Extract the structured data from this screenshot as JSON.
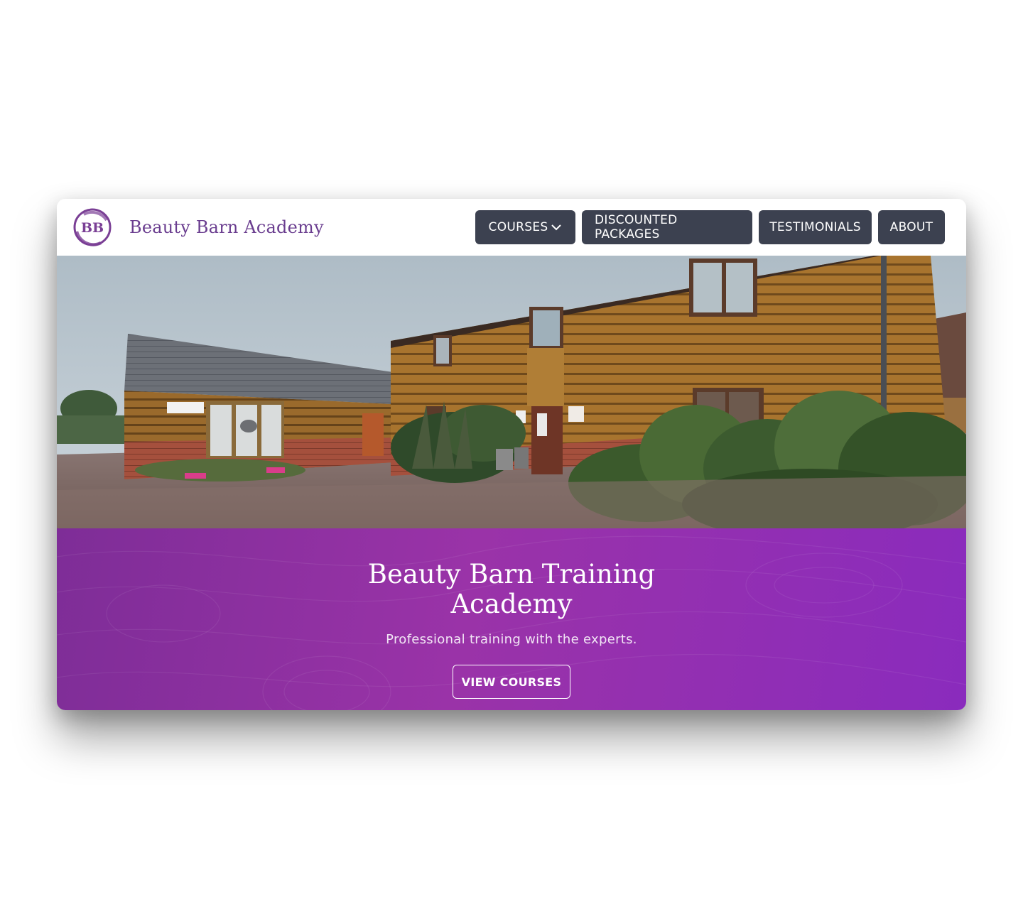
{
  "brand": {
    "logo_text": "BB",
    "name": "Beauty Barn Academy"
  },
  "nav": {
    "courses": "COURSES",
    "packages": "DISCOUNTED PACKAGES",
    "testimonials": "TESTIMONIALS",
    "about": "ABOUT"
  },
  "carousel": {
    "slide_count": 5,
    "active_index": 0
  },
  "hero": {
    "title": "Beauty Barn Training Academy",
    "subtitle": "Professional training with the experts.",
    "cta_label": "VIEW COURSES"
  },
  "colors": {
    "brand_purple": "#6a3d8f",
    "nav_button": "#3c4150",
    "band_purple": "#8a2bbd"
  }
}
